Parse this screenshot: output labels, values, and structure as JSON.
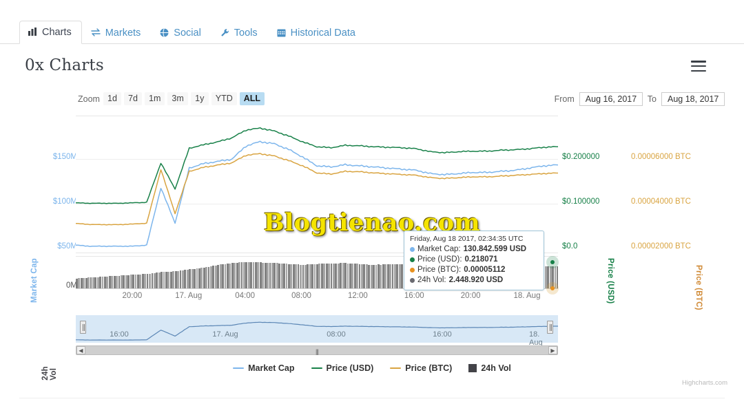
{
  "tabs": [
    {
      "label": "Charts",
      "icon": "bar-chart-icon",
      "glyph": "▐▌",
      "active": true
    },
    {
      "label": "Markets",
      "icon": "exchange-arrows-icon",
      "glyph": "⇄",
      "active": false
    },
    {
      "label": "Social",
      "icon": "globe-icon",
      "glyph": "ἱ0",
      "active": false
    },
    {
      "label": "Tools",
      "icon": "wrench-icon",
      "glyph": "ὒ7",
      "active": false
    },
    {
      "label": "Historical Data",
      "icon": "calendar-icon",
      "glyph": "Ὄ5",
      "active": false
    }
  ],
  "header": {
    "title": "0x Charts",
    "menu_icon": "hamburger-menu-icon"
  },
  "rangeselector": {
    "zoom_label": "Zoom",
    "buttons": [
      {
        "label": "1d",
        "active": false
      },
      {
        "label": "7d",
        "active": false
      },
      {
        "label": "1m",
        "active": false
      },
      {
        "label": "3m",
        "active": false
      },
      {
        "label": "1y",
        "active": false
      },
      {
        "label": "YTD",
        "active": false
      },
      {
        "label": "ALL",
        "active": true
      }
    ],
    "from_label": "From",
    "from_value": "Aug 16, 2017",
    "to_label": "To",
    "to_value": "Aug 18, 2017"
  },
  "tooltip": {
    "date": "Friday, Aug 18 2017, 02:34:35 UTC",
    "rows": [
      {
        "name": "Market Cap:",
        "value": "130.842.599 USD",
        "color": "#7cb5ec"
      },
      {
        "name": "Price (USD):",
        "value": "0.218071",
        "color": "#178048"
      },
      {
        "name": "Price (BTC):",
        "value": "0.00005112",
        "color": "#e8921f"
      },
      {
        "name": "24h Vol:",
        "value": "2.448.920 USD",
        "color": "#6a6a70"
      }
    ]
  },
  "legend": [
    {
      "label": "Market Cap",
      "color": "#7cb5ec",
      "marker": "line"
    },
    {
      "label": "Price (USD)",
      "color": "#178048",
      "marker": "line"
    },
    {
      "label": "Price (BTC)",
      "color": "#d9a441",
      "marker": "line"
    },
    {
      "label": "24h Vol",
      "color": "#434348",
      "marker": "square"
    }
  ],
  "watermark": "Blogtienao.com",
  "credit": "Highcharts.com",
  "navigator": {
    "xticks": [
      {
        "label": "16:00",
        "pos": 9
      },
      {
        "label": "17. Aug",
        "pos": 31
      },
      {
        "label": "08:00",
        "pos": 54
      },
      {
        "label": "16:00",
        "pos": 76
      },
      {
        "label": "18. Aug",
        "pos": 96
      }
    ],
    "scroll_left_icon": "scroll-left-arrow-icon",
    "scroll_right_icon": "scroll-right-arrow-icon",
    "scroll_grip": "|||"
  },
  "chart_data": {
    "type": "line",
    "title": "0x Charts",
    "xlabel": "",
    "grid": true,
    "legend_position": "bottom",
    "x": [
      "16:00",
      "17:00",
      "18:00",
      "19:00",
      "20:00",
      "21:00",
      "22:00",
      "23:00",
      "00:00",
      "01:00",
      "02:00",
      "03:00",
      "04:00",
      "05:00",
      "06:00",
      "07:00",
      "08:00",
      "09:00",
      "10:00",
      "11:00",
      "12:00",
      "13:00",
      "14:00",
      "15:00",
      "16:00",
      "17:00",
      "18:00",
      "19:00",
      "20:00",
      "21:00",
      "22:00",
      "23:00",
      "00:00",
      "01:00",
      "02:34"
    ],
    "xtick_labels": [
      "20:00",
      "17. Aug",
      "04:00",
      "08:00",
      "12:00",
      "16:00",
      "20:00",
      "18. Aug"
    ],
    "axes": [
      {
        "name": "Market Cap",
        "side": "left",
        "color": "#7cb5ec",
        "ticks": [
          "$150M",
          "$100M",
          "$50M"
        ],
        "tick_values": [
          150,
          100,
          50
        ],
        "ylim": [
          50,
          175
        ]
      },
      {
        "name": "Price (USD)",
        "side": "right",
        "color": "#178048",
        "ticks": [
          "$0.200000",
          "$0.100000",
          "$0.0"
        ],
        "tick_values": [
          0.2,
          0.1,
          0.0
        ],
        "ylim": [
          0.0,
          0.28
        ]
      },
      {
        "name": "Price (BTC)",
        "side": "right",
        "color": "#d9a441",
        "ticks": [
          "0.00006000 BTC",
          "0.00004000 BTC",
          "0.00002000 BTC"
        ],
        "tick_values": [
          6e-05,
          4e-05,
          2e-05
        ],
        "ylim": [
          1e-05,
          8e-05
        ]
      },
      {
        "name": "24h Vol",
        "side": "left",
        "color": "#434348",
        "ticks": [
          "0M"
        ],
        "tick_values": [
          0
        ],
        "ylim": [
          0,
          3.5
        ]
      }
    ],
    "series": [
      {
        "name": "Market Cap",
        "color": "#7cb5ec",
        "axis": "Market Cap",
        "unit": "USD millions",
        "values": [
          58,
          57,
          57,
          57,
          57,
          58,
          110,
          78,
          128,
          132,
          134,
          136,
          148,
          152,
          150,
          145,
          138,
          130,
          129,
          131,
          130,
          129,
          128,
          127,
          126,
          123,
          122,
          123,
          124,
          124,
          125,
          126,
          128,
          130,
          130.8
        ]
      },
      {
        "name": "Price (USD)",
        "color": "#178048",
        "axis": "Price (USD)",
        "unit": "USD",
        "values": [
          0.104,
          0.103,
          0.103,
          0.103,
          0.104,
          0.105,
          0.185,
          0.132,
          0.215,
          0.222,
          0.228,
          0.236,
          0.252,
          0.256,
          0.25,
          0.24,
          0.228,
          0.218,
          0.216,
          0.221,
          0.22,
          0.218,
          0.217,
          0.216,
          0.214,
          0.208,
          0.206,
          0.208,
          0.209,
          0.209,
          0.211,
          0.212,
          0.214,
          0.217,
          0.218071
        ]
      },
      {
        "name": "Price (BTC)",
        "color": "#d9a441",
        "axis": "Price (BTC)",
        "unit": "BTC",
        "values": [
          2.55e-05,
          2.5e-05,
          2.49e-05,
          2.49e-05,
          2.52e-05,
          2.56e-05,
          5.3e-05,
          3.05e-05,
          5.2e-05,
          5.4e-05,
          5.52e-05,
          5.63e-05,
          6.02e-05,
          6.1e-05,
          5.98e-05,
          5.75e-05,
          5.48e-05,
          5.12e-05,
          5.06e-05,
          5.2e-05,
          5.18e-05,
          5.12e-05,
          5.08e-05,
          5.04e-05,
          5e-05,
          4.88e-05,
          4.84e-05,
          4.88e-05,
          4.92e-05,
          4.92e-05,
          4.96e-05,
          5e-05,
          5.04e-05,
          5.09e-05,
          5.112e-05
        ]
      },
      {
        "name": "24h Vol",
        "color": "#434348",
        "axis": "24h Vol",
        "unit": "USD millions",
        "values": [
          1.1,
          1.2,
          1.3,
          1.4,
          1.5,
          1.6,
          1.8,
          1.9,
          2.1,
          2.3,
          2.6,
          2.8,
          2.9,
          2.85,
          2.8,
          2.7,
          2.6,
          2.7,
          2.75,
          2.8,
          2.7,
          2.6,
          2.65,
          2.7,
          2.6,
          2.4,
          2.3,
          2.35,
          2.4,
          2.5,
          2.55,
          2.5,
          2.45,
          2.45,
          2.448
        ]
      }
    ]
  }
}
